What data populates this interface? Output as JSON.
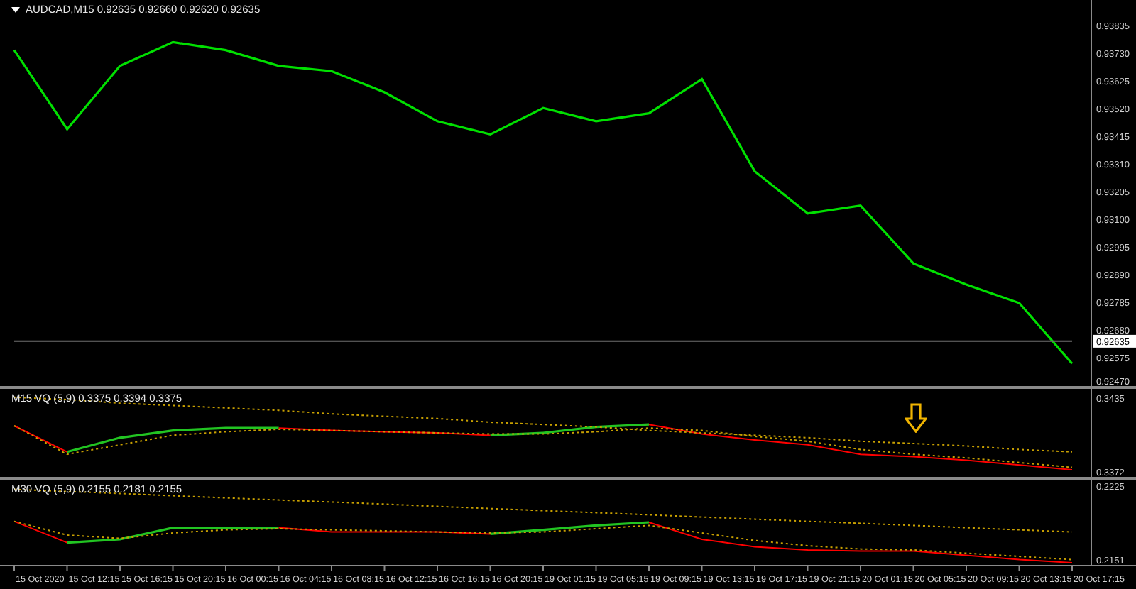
{
  "price_panel": {
    "title": "AUDCAD,M15  0.92635 0.92660 0.92620 0.92635",
    "current_price": "0.92635",
    "chart_data": {
      "type": "line",
      "series": [
        {
          "color": "#00e000",
          "values": [
            0.9374,
            0.9344,
            0.9368,
            0.9377,
            0.9374,
            0.9368,
            0.9366,
            0.9358,
            0.9347,
            0.9342,
            0.9352,
            0.9347,
            0.935,
            0.9363,
            0.9328,
            0.9312,
            0.9315,
            0.9293,
            0.9285,
            0.9278,
            0.9255
          ]
        },
        {
          "color": "#6e6e6e",
          "values": [
            0.92635,
            0.92635,
            0.92635,
            0.92635,
            0.92635,
            0.92635,
            0.92635,
            0.92635,
            0.92635,
            0.92635,
            0.92635,
            0.92635,
            0.92635,
            0.92635,
            0.92635,
            0.92635,
            0.92635,
            0.92635,
            0.92635,
            0.92635,
            0.92635
          ]
        }
      ],
      "ylim": [
        0.92465,
        0.9393
      ],
      "yticks": [
        {
          "value": 0.93835,
          "label": "0.93835"
        },
        {
          "value": 0.9373,
          "label": "0.93730"
        },
        {
          "value": 0.93625,
          "label": "0.93625"
        },
        {
          "value": 0.9352,
          "label": "0.93520"
        },
        {
          "value": 0.93415,
          "label": "0.93415"
        },
        {
          "value": 0.9331,
          "label": "0.93310"
        },
        {
          "value": 0.93205,
          "label": "0.93205"
        },
        {
          "value": 0.931,
          "label": "0.93100"
        },
        {
          "value": 0.92995,
          "label": "0.92995"
        },
        {
          "value": 0.9289,
          "label": "0.92890"
        },
        {
          "value": 0.92785,
          "label": "0.92785"
        },
        {
          "value": 0.9268,
          "label": "0.92680"
        },
        {
          "value": 0.92575,
          "label": "0.92575"
        },
        {
          "value": 0.9247,
          "label": "0.92470"
        }
      ]
    }
  },
  "indicators": [
    {
      "title": "M15 VQ (5,9) 0.3375 0.3394 0.3375",
      "chart_data": {
        "type": "line",
        "ylim": [
          0.3368,
          0.3442
        ],
        "yticks": [
          {
            "value": 0.3435,
            "label": "0.3435"
          },
          {
            "value": 0.3372,
            "label": "0.3372"
          }
        ],
        "series": [
          {
            "color": "#22c422",
            "values": [
              null,
              0.3389,
              0.3401,
              0.3407,
              0.3409,
              0.3409,
              null,
              null,
              null,
              0.3403,
              0.3405,
              0.341,
              0.3412,
              null,
              null,
              null,
              null,
              null,
              null,
              null,
              null
            ]
          },
          {
            "color": "#ff0000",
            "values": [
              0.3411,
              0.3389,
              null,
              null,
              null,
              0.3409,
              0.3407,
              0.3406,
              0.3405,
              0.3403,
              null,
              null,
              0.3412,
              0.3404,
              0.3399,
              0.3395,
              0.3387,
              0.3385,
              0.3382,
              0.3378,
              0.3374
            ]
          },
          {
            "color": "#c8a000",
            "line_style": "dotted",
            "values": [
              0.3411,
              0.3387,
              0.3395,
              0.3403,
              0.3406,
              0.3408,
              0.3407,
              0.3406,
              0.3405,
              0.3404,
              0.3404,
              0.3406,
              0.3409,
              0.3407,
              0.3402,
              0.3398,
              0.3391,
              0.3387,
              0.3384,
              0.338,
              0.3376
            ]
          },
          {
            "color": "#c8a000",
            "line_style": "dotted",
            "values": [
              0.3435,
              0.3433,
              0.343,
              0.3428,
              0.3426,
              0.3424,
              0.3421,
              0.3419,
              0.3417,
              0.3414,
              0.3412,
              0.341,
              0.3407,
              0.3405,
              0.3403,
              0.3401,
              0.3398,
              0.3396,
              0.3394,
              0.3391,
              0.3389
            ]
          }
        ]
      }
    },
    {
      "title": "M30 VQ (5,9) 0.2155 0.2181 0.2155",
      "chart_data": {
        "type": "line",
        "ylim": [
          0.215,
          0.223
        ],
        "yticks": [
          {
            "value": 0.2225,
            "label": "0.2225"
          },
          {
            "value": 0.2151,
            "label": "0.2151"
          }
        ],
        "series": [
          {
            "color": "#22c422",
            "values": [
              null,
              0.2171,
              0.2174,
              0.2185,
              0.2185,
              0.2185,
              null,
              null,
              null,
              0.2179,
              0.2183,
              0.2187,
              0.219,
              null,
              null,
              null,
              null,
              null,
              null,
              null,
              null
            ]
          },
          {
            "color": "#ff0000",
            "values": [
              0.2191,
              0.2171,
              null,
              null,
              null,
              0.2185,
              0.2181,
              0.2181,
              0.2181,
              0.2179,
              null,
              null,
              0.219,
              0.2174,
              0.2167,
              0.2164,
              0.2163,
              0.2163,
              0.2159,
              0.2155,
              0.2152
            ]
          },
          {
            "color": "#c8a000",
            "line_style": "dotted",
            "values": [
              0.2191,
              0.2178,
              0.2175,
              0.218,
              0.2183,
              0.2184,
              0.2183,
              0.2182,
              0.2181,
              0.218,
              0.2181,
              0.2184,
              0.2187,
              0.218,
              0.2173,
              0.2168,
              0.2165,
              0.2164,
              0.2161,
              0.2158,
              0.2155
            ]
          },
          {
            "color": "#c8a000",
            "line_style": "dotted",
            "values": [
              0.2221,
              0.2219,
              0.2217,
              0.2215,
              0.2213,
              0.2211,
              0.2209,
              0.2207,
              0.2205,
              0.2203,
              0.2201,
              0.2199,
              0.2197,
              0.2195,
              0.2193,
              0.2191,
              0.2189,
              0.2187,
              0.2185,
              0.2183,
              0.2181
            ]
          }
        ]
      }
    }
  ],
  "time_axis": [
    "15 Oct 2020",
    "15 Oct 12:15",
    "15 Oct 16:15",
    "15 Oct 20:15",
    "16 Oct 00:15",
    "16 Oct 04:15",
    "16 Oct 08:15",
    "16 Oct 12:15",
    "16 Oct 16:15",
    "16 Oct 20:15",
    "19 Oct 01:15",
    "19 Oct 05:15",
    "19 Oct 09:15",
    "19 Oct 13:15",
    "19 Oct 17:15",
    "19 Oct 21:15",
    "20 Oct 01:15",
    "20 Oct 05:15",
    "20 Oct 09:15",
    "20 Oct 13:15",
    "20 Oct 17:15"
  ]
}
